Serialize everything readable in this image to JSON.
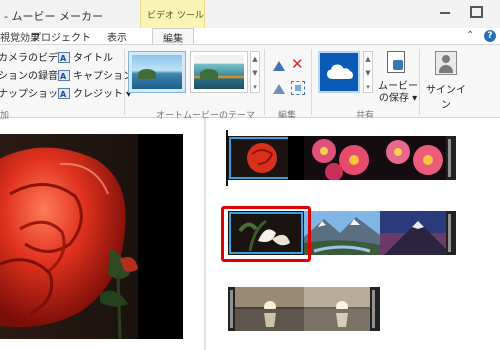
{
  "app": {
    "title": "- ムービー メーカー",
    "context_tab_header": "ビデオ ツール"
  },
  "tabs": [
    "視覚効果",
    "プロジェクト",
    "表示",
    "編集"
  ],
  "ribbon": {
    "add_group": {
      "webcam_video": "カメラのビデオ",
      "record_narration": "ションの録音 ▾",
      "snapshot": "ナップショット",
      "title": "タイトル",
      "caption": "キャプション",
      "credits": "クレジット ▾",
      "group_label": "加"
    },
    "theme_group": {
      "group_label": "オートムービーのテーマ"
    },
    "edit_group": {
      "group_label": "編集"
    },
    "share_group": {
      "save_movie_line1": "ムービー",
      "save_movie_line2": "の保存 ▾",
      "group_label": "共有"
    },
    "signin": "サインイン"
  },
  "colors": {
    "selection": "#e00000",
    "accent": "#0a5bb5",
    "context_tab": "#faf3b6"
  },
  "icons": {
    "scroll_up": "▲",
    "scroll_down": "▼",
    "scroll_more": "▾",
    "delete": "✕",
    "help": "?",
    "collapse": "⌃"
  }
}
